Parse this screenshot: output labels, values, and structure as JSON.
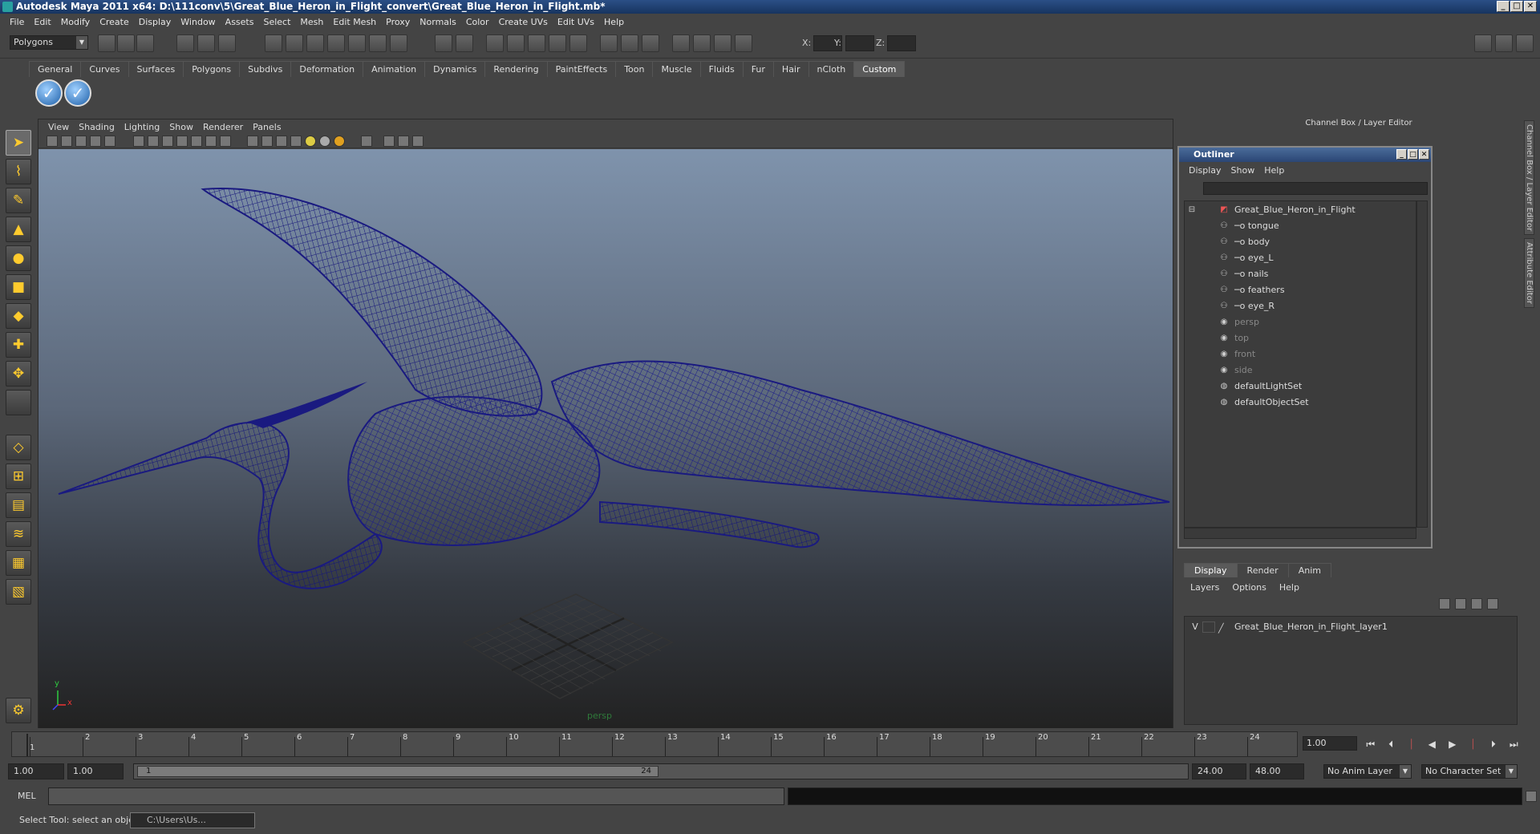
{
  "window": {
    "title": "Autodesk Maya 2011 x64: D:\\111conv\\5\\Great_Blue_Heron_in_Flight_convert\\Great_Blue_Heron_in_Flight.mb*"
  },
  "menu": [
    "File",
    "Edit",
    "Modify",
    "Create",
    "Display",
    "Window",
    "Assets",
    "Select",
    "Mesh",
    "Edit Mesh",
    "Proxy",
    "Normals",
    "Color",
    "Create UVs",
    "Edit UVs",
    "Help"
  ],
  "status": {
    "mode": "Polygons",
    "x_label": "X:",
    "y_label": "Y:",
    "z_label": "Z:"
  },
  "shelf": {
    "tabs": [
      "General",
      "Curves",
      "Surfaces",
      "Polygons",
      "Subdivs",
      "Deformation",
      "Animation",
      "Dynamics",
      "Rendering",
      "PaintEffects",
      "Toon",
      "Muscle",
      "Fluids",
      "Fur",
      "Hair",
      "nCloth",
      "Custom"
    ],
    "active_tab": "Custom"
  },
  "viewport": {
    "menu": [
      "View",
      "Shading",
      "Lighting",
      "Show",
      "Renderer",
      "Panels"
    ],
    "camera_label": "persp",
    "axis_y": "y",
    "axis_x": "x"
  },
  "channel_box": {
    "title": "Channel Box / Layer Editor",
    "side_tabs": [
      "Channel Box / Layer Editor",
      "Attribute Editor"
    ]
  },
  "outliner": {
    "title": "Outliner",
    "menu": [
      "Display",
      "Show",
      "Help"
    ],
    "root": "Great_Blue_Heron_in_Flight",
    "children": [
      "tongue",
      "body",
      "eye_L",
      "nails",
      "feathers",
      "eye_R"
    ],
    "cameras": [
      "persp",
      "top",
      "front",
      "side"
    ],
    "sets": [
      "defaultLightSet",
      "defaultObjectSet"
    ]
  },
  "layer_editor": {
    "tabs": [
      "Display",
      "Render",
      "Anim"
    ],
    "active_tab": "Display",
    "menu": [
      "Layers",
      "Options",
      "Help"
    ],
    "layer_visibility": "V",
    "layer_name": "Great_Blue_Heron_in_Flight_layer1"
  },
  "timeline": {
    "ticks": [
      "1",
      "2",
      "3",
      "4",
      "5",
      "6",
      "7",
      "8",
      "9",
      "10",
      "11",
      "12",
      "13",
      "14",
      "15",
      "16",
      "17",
      "18",
      "19",
      "20",
      "21",
      "22",
      "23",
      "24"
    ],
    "current_frame": "1.00",
    "current_marker": "1"
  },
  "range": {
    "start": "1.00",
    "anim_start": "1.00",
    "slider_start": "1",
    "slider_end": "24",
    "anim_end": "24.00",
    "end": "48.00",
    "anim_layer": "No Anim Layer",
    "char_set": "No Character Set"
  },
  "command": {
    "mel_label": "MEL"
  },
  "helpline": {
    "text": "Select Tool: select an object",
    "taskbar_item": "C:\\Users\\Us..."
  }
}
